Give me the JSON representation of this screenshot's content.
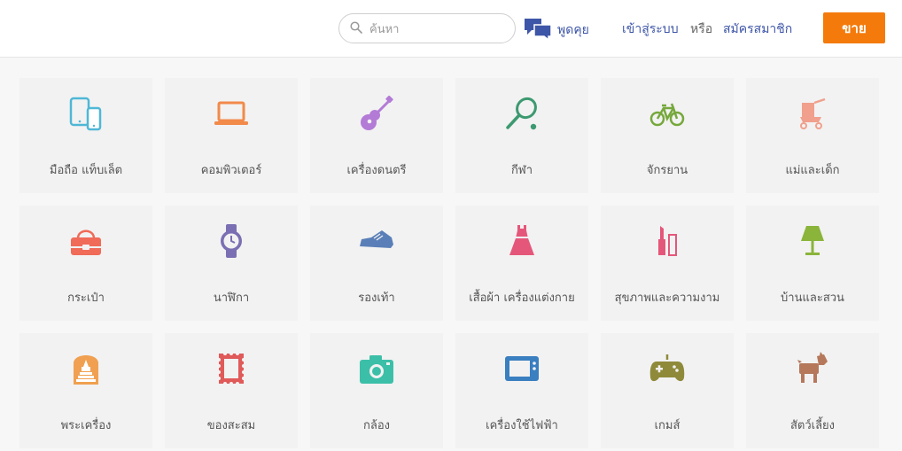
{
  "header": {
    "search": {
      "placeholder": "ค้นหา",
      "value": ""
    },
    "chat_label": "พูดคุย",
    "login_label": "เข้าสู่ระบบ",
    "or_label": "หรือ",
    "register_label": "สมัครสมาชิก",
    "sell_label": "ขาย",
    "colors": {
      "link": "#3e56a8",
      "sell": "#f47b0b"
    }
  },
  "categories": [
    {
      "label": "มือถือ แท็บเล็ต",
      "icon": "phone-tablet-icon"
    },
    {
      "label": "คอมพิวเตอร์",
      "icon": "laptop-icon"
    },
    {
      "label": "เครื่องดนตรี",
      "icon": "guitar-icon"
    },
    {
      "label": "กีฬา",
      "icon": "tennis-racket-icon"
    },
    {
      "label": "จักรยาน",
      "icon": "bicycle-icon"
    },
    {
      "label": "แม่และเด็ก",
      "icon": "stroller-icon"
    },
    {
      "label": "กระเป๋า",
      "icon": "handbag-icon"
    },
    {
      "label": "นาฬิกา",
      "icon": "watch-icon"
    },
    {
      "label": "รองเท้า",
      "icon": "shoe-icon"
    },
    {
      "label": "เสื้อผ้า เครื่องแต่งกาย",
      "icon": "dress-icon"
    },
    {
      "label": "สุขภาพและความงาม",
      "icon": "lipstick-icon"
    },
    {
      "label": "บ้านและสวน",
      "icon": "lamp-icon"
    },
    {
      "label": "พระเครื่อง",
      "icon": "amulet-icon"
    },
    {
      "label": "ของสะสม",
      "icon": "stamp-icon"
    },
    {
      "label": "กล้อง",
      "icon": "camera-icon"
    },
    {
      "label": "เครื่องใช้ไฟฟ้า",
      "icon": "television-icon"
    },
    {
      "label": "เกมส์",
      "icon": "gamepad-icon"
    },
    {
      "label": "สัตว์เลี้ยง",
      "icon": "dog-icon"
    }
  ]
}
